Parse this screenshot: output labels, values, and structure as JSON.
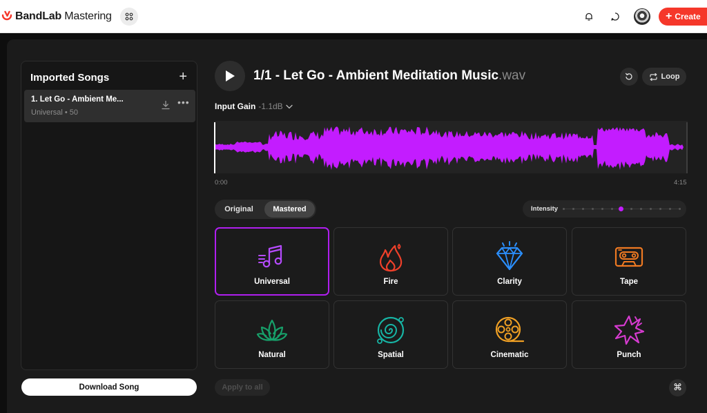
{
  "header": {
    "brand_name": "BandLab",
    "brand_product": "Mastering",
    "create_label": "Create",
    "icons": [
      "bandlab-logo-icon",
      "apps-grid-icon",
      "bell-icon",
      "message-icon",
      "avatar",
      "plus-icon"
    ]
  },
  "sidebar": {
    "title": "Imported Songs",
    "songs": [
      {
        "name": "1. Let Go - Ambient Me...",
        "meta": "Universal • 50"
      }
    ],
    "download_label": "Download Song"
  },
  "player": {
    "title": "1/1 - Let Go - Ambient Meditation Music",
    "title_ext": ".wav",
    "loop_label": "Loop",
    "input_gain_label": "Input Gain",
    "input_gain_value": "-1.1dB",
    "time_start": "0:00",
    "time_end": "4:15",
    "playhead_position": 0
  },
  "mode_toggle": {
    "options": [
      "Original",
      "Mastered"
    ],
    "selected": "Mastered"
  },
  "intensity": {
    "label": "Intensity",
    "level_fraction": 0.5
  },
  "presets": [
    {
      "label": "Universal",
      "icon": "music-notes-icon",
      "color": "#b64bff",
      "selected": true
    },
    {
      "label": "Fire",
      "icon": "flame-icon",
      "color": "#f0402a",
      "selected": false
    },
    {
      "label": "Clarity",
      "icon": "diamond-icon",
      "color": "#2b8fff",
      "selected": false
    },
    {
      "label": "Tape",
      "icon": "cassette-icon",
      "color": "#f07a22",
      "selected": false
    },
    {
      "label": "Natural",
      "icon": "lotus-icon",
      "color": "#17a06a",
      "selected": false
    },
    {
      "label": "Spatial",
      "icon": "spiral-galaxy-icon",
      "color": "#17b5a5",
      "selected": false
    },
    {
      "label": "Cinematic",
      "icon": "film-reel-icon",
      "color": "#f0a024",
      "selected": false
    },
    {
      "label": "Punch",
      "icon": "burst-icon",
      "color": "#d63bd0",
      "selected": false
    }
  ],
  "footer": {
    "apply_label": "Apply to all",
    "shortcut_symbol": "⌘"
  },
  "colors": {
    "accent_purple": "#b01ff0",
    "waveform": "#c31cff",
    "create_red": "#f5372a",
    "background": "#1b1b1b"
  }
}
